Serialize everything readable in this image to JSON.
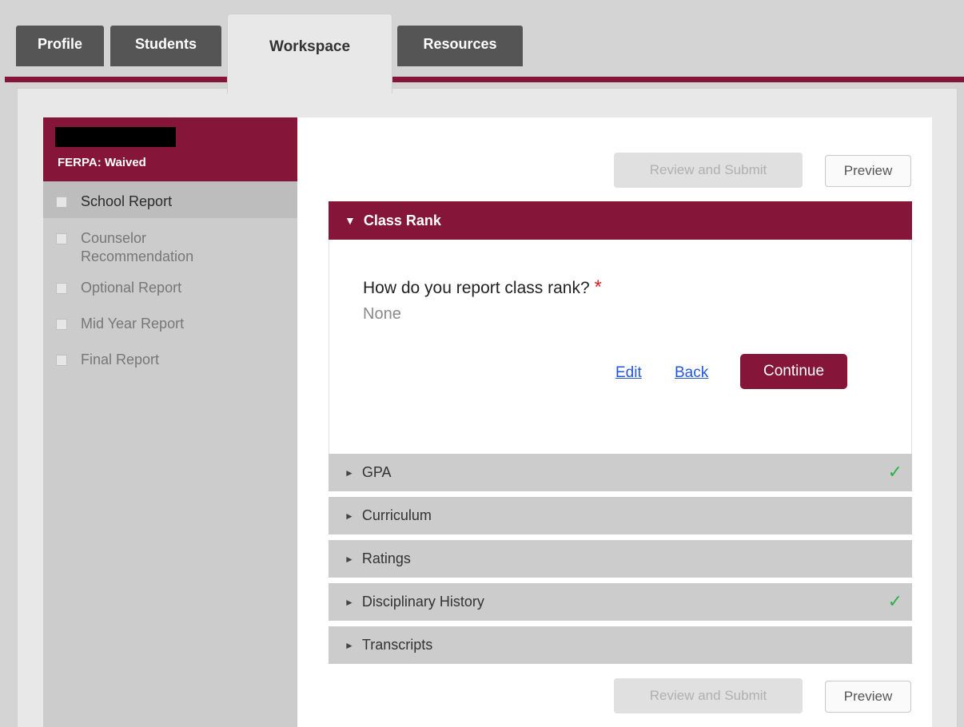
{
  "tabs": [
    {
      "label": "Profile",
      "active": false
    },
    {
      "label": "Students",
      "active": false
    },
    {
      "label": "Workspace",
      "active": true
    },
    {
      "label": "Resources",
      "active": false
    }
  ],
  "student": {
    "ferpa_status": "FERPA: Waived"
  },
  "sidebar": {
    "items": [
      {
        "label": "School Report",
        "selected": true
      },
      {
        "label": "Counselor Recommendation",
        "selected": false
      },
      {
        "label": "Optional Report",
        "selected": false
      },
      {
        "label": "Mid Year Report",
        "selected": false
      },
      {
        "label": "Final Report",
        "selected": false
      }
    ]
  },
  "toolbar": {
    "review_submit_label": "Review and Submit",
    "preview_label": "Preview"
  },
  "open_section": {
    "title": "Class Rank",
    "question": "How do you report class rank?",
    "required_marker": "*",
    "answer": "None",
    "edit_label": "Edit",
    "back_label": "Back",
    "continue_label": "Continue"
  },
  "sections": [
    {
      "title": "GPA",
      "complete": true
    },
    {
      "title": "Curriculum",
      "complete": false
    },
    {
      "title": "Ratings",
      "complete": false
    },
    {
      "title": "Disciplinary History",
      "complete": true
    },
    {
      "title": "Transcripts",
      "complete": false
    }
  ],
  "icons": {
    "expanded": "▼",
    "collapsed": "►",
    "complete": "✓"
  },
  "colors": {
    "brand": "#85163a",
    "complete": "#2bb24c",
    "link": "#2457d8"
  }
}
